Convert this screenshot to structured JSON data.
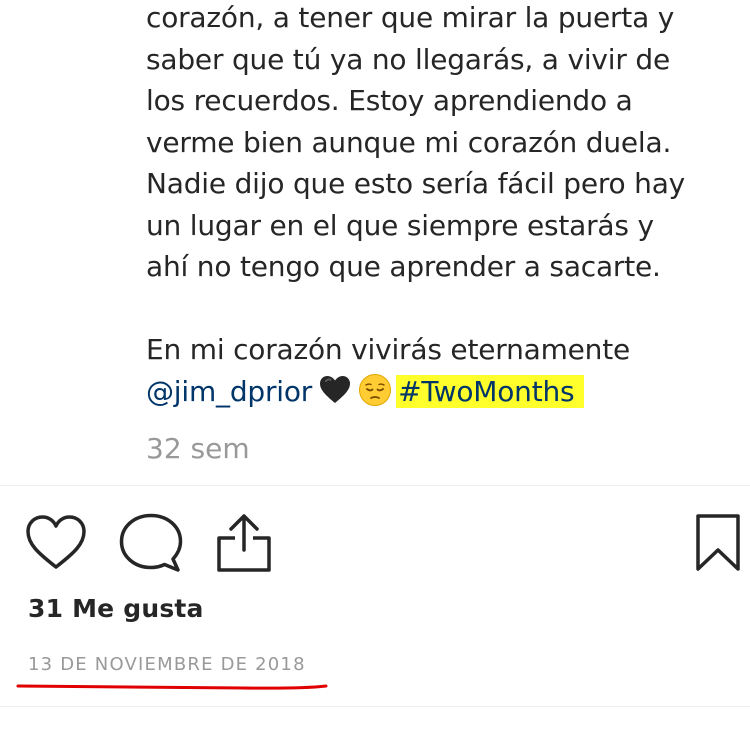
{
  "caption": {
    "lines": [
      "corazón, a tener que mirar la puerta y",
      "saber que tú ya no llegarás, a vivir de",
      "los recuerdos. Estoy aprendiendo a",
      "verme bien aunque mi corazón duela.",
      "Nadie dijo que esto sería fácil pero hay",
      "un lugar en el que siempre estarás y",
      "ahí no tengo que aprender a sacarte."
    ],
    "closing_line": "En mi corazón vivirás eternamente",
    "mention": "@jim_dprior",
    "emojis": [
      "black-heart",
      "pensive-face"
    ],
    "hashtag": "#TwoMonths"
  },
  "time_ago": "32 sem",
  "actions": {
    "icons": [
      "heart-icon",
      "comment-icon",
      "share-icon",
      "bookmark-icon"
    ]
  },
  "likes": "31 Me gusta",
  "date": "13 DE NOVIEMBRE DE 2018",
  "colors": {
    "text": "#262626",
    "muted": "#999999",
    "highlight": "#ffff2b",
    "underline": "#e00000"
  }
}
